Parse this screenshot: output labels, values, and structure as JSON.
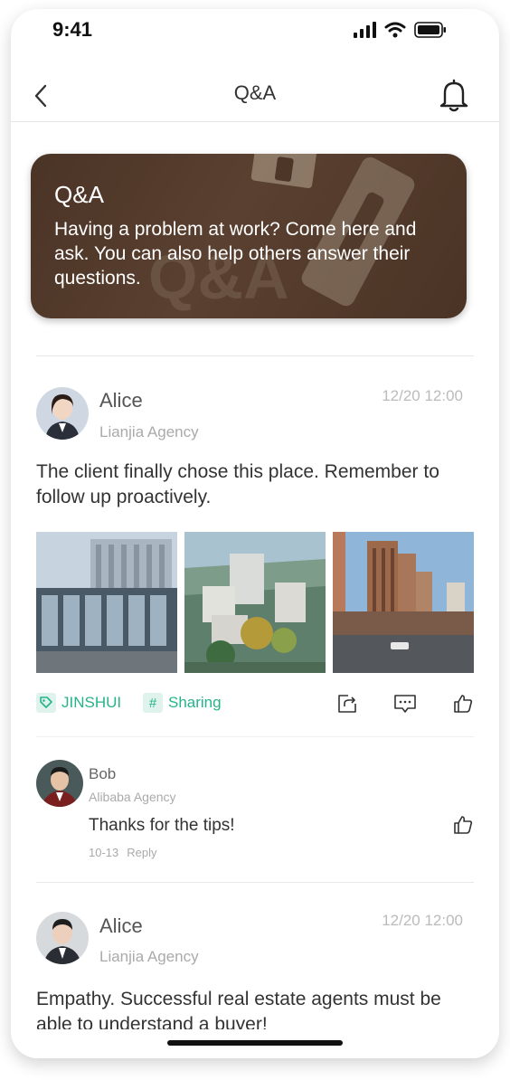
{
  "status_bar": {
    "time": "9:41"
  },
  "nav": {
    "title": "Q&A"
  },
  "banner": {
    "title": "Q&A",
    "description": "Having a problem at work? Come here and ask. You can also help others answer their questions."
  },
  "posts": [
    {
      "author": "Alice",
      "agency": "Lianjia Agency",
      "time": "12/20 12:00",
      "text": "The client finally chose this place. Remember to follow up proactively.",
      "tags": [
        "JINSHUI",
        "Sharing"
      ],
      "comment": {
        "author": "Bob",
        "agency": "Alibaba Agency",
        "text": "Thanks for the tips!",
        "date": "10-13",
        "reply_label": "Reply"
      }
    },
    {
      "author": "Alice",
      "agency": "Lianjia Agency",
      "time": "12/20 12:00",
      "text": "Empathy. Successful real estate agents must be able to understand a buyer!"
    }
  ],
  "colors": {
    "accent": "#26b38a",
    "banner": "#4f3829"
  }
}
